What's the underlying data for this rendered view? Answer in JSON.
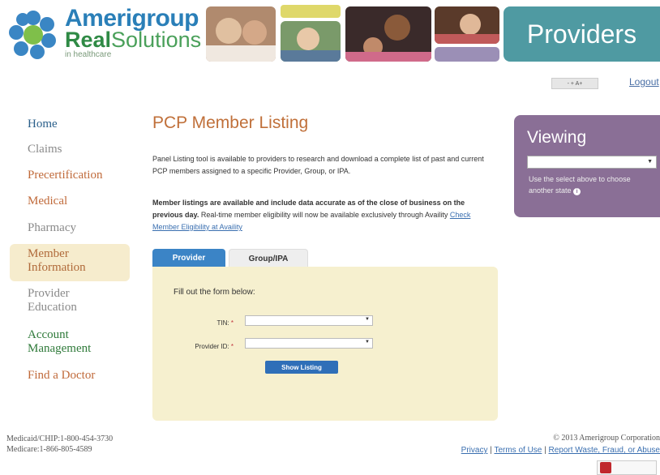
{
  "header": {
    "logo_line1": "Amerigroup",
    "logo_line2_bold": "Real",
    "logo_line2_rest": "Solutions",
    "logo_line3": "in healthcare",
    "section_title": "Providers",
    "font_size_controls": "- + A+",
    "logout": "Logout"
  },
  "nav": {
    "items": [
      {
        "label": "Home"
      },
      {
        "label": "Claims"
      },
      {
        "label": "Precertification"
      },
      {
        "label": "Medical"
      },
      {
        "label": "Pharmacy"
      },
      {
        "label": "Member Information"
      },
      {
        "label": "Provider Education"
      },
      {
        "label": "Account Management"
      },
      {
        "label": "Find a Doctor"
      }
    ]
  },
  "main": {
    "title": "PCP Member Listing",
    "para1": "Panel Listing tool is available to providers to research and download a complete list of past and current PCP members assigned to a specific Provider, Group, or IPA.",
    "para2_bold": "Member listings are available and include data accurate as of the close of business on the previous day.",
    "para2_rest": " Real-time member eligibility will now be available exclusively through Availity ",
    "para2_link": "Check Member Eligibility at Availity",
    "tabs": [
      {
        "label": "Provider"
      },
      {
        "label": "Group/IPA"
      }
    ],
    "form": {
      "intro": "Fill out the form below:",
      "tin_label": "TIN: ",
      "provider_label": "Provider ID: ",
      "required_mark": "*",
      "show_button": "Show Listing"
    }
  },
  "viewing": {
    "title": "Viewing",
    "note": "Use the select above to choose another state"
  },
  "footer": {
    "phone1": "Medicaid/CHIP:1-800-454-3730",
    "phone2": "Medicare:1-866-805-4589",
    "copyright": "© 2013 Amerigroup Corporation",
    "link_privacy": "Privacy",
    "link_terms": "Terms of Use",
    "link_report": "Report Waste, Fraud, or Abuse",
    "sep": " | "
  },
  "colors": {
    "brand_blue": "#2a7fb8",
    "brand_green": "#4aa05a",
    "providers_teal": "#4f9aa2",
    "viewing_purple": "#8a6f96",
    "form_bg": "#f6f0cf",
    "active_tab": "#3b84c6",
    "title_orange": "#c0703a"
  }
}
